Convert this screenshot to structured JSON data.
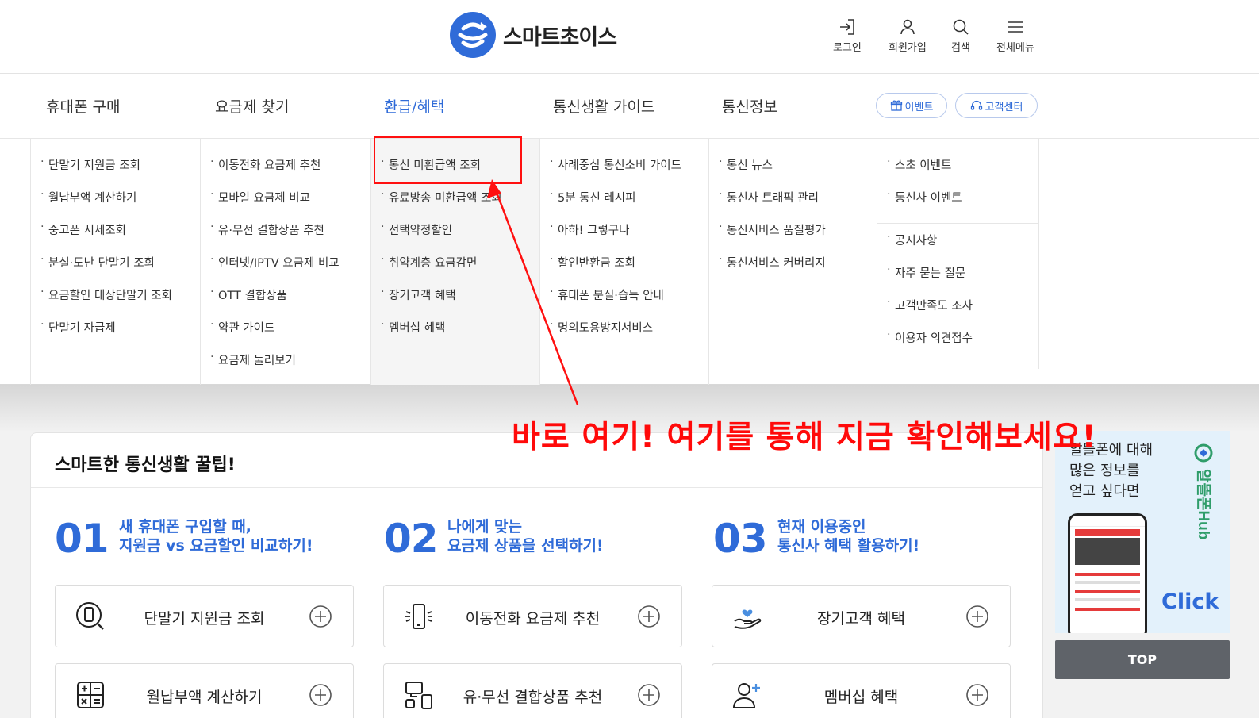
{
  "header": {
    "logo_text": "스마트초이스",
    "util": {
      "login": "로그인",
      "signup": "회원가입",
      "search": "검색",
      "all_menu": "전체메뉴"
    }
  },
  "gnb": {
    "items": [
      "휴대폰 구매",
      "요금제 찾기",
      "환급/혜택",
      "통신생활 가이드",
      "통신정보"
    ],
    "event_label": "이벤트",
    "support_label": "고객센터"
  },
  "mega_menu": {
    "col1": [
      "단말기 지원금 조회",
      "월납부액 계산하기",
      "중고폰 시세조회",
      "분실·도난 단말기 조회",
      "요금할인 대상단말기 조회",
      "단말기 자급제"
    ],
    "col2": [
      "이동전화 요금제 추천",
      "모바일 요금제 비교",
      "유·무선 결합상품 추천",
      "인터넷/IPTV 요금제 비교",
      "OTT 결합상품",
      "약관 가이드",
      "요금제 둘러보기"
    ],
    "col3": [
      "통신 미환급액 조회",
      "유료방송 미환급액 조회",
      "선택약정할인",
      "취약계층 요금감면",
      "장기고객 혜택",
      "멤버십 혜택"
    ],
    "col4": [
      "사례중심 통신소비 가이드",
      "5분 통신 레시피",
      "아하! 그렇구나",
      "할인반환금 조회",
      "휴대폰 분실·습득 안내",
      "명의도용방지서비스"
    ],
    "col5": [
      "통신 뉴스",
      "통신사 트래픽 관리",
      "통신서비스 품질평가",
      "통신서비스 커버리지"
    ],
    "col6_top": [
      "스초 이벤트",
      "통신사 이벤트"
    ],
    "col6_bottom": [
      "공지사항",
      "자주 묻는 질문",
      "고객만족도 조사",
      "이용자 의견접수"
    ]
  },
  "annotation": {
    "text": "바로 여기! 여기를 통해 지금 확인해보세요!",
    "color": "#ff0a0a"
  },
  "tips": {
    "title": "스마트한 통신생활 꿀팁!",
    "sections": [
      {
        "num": "01",
        "line1": "새 휴대폰 구입할 때,",
        "line2": "지원금 vs 요금할인 비교하기!",
        "items": [
          "단말기 지원금 조회",
          "월납부액 계산하기"
        ]
      },
      {
        "num": "02",
        "line1": "나에게 맞는",
        "line2": "요금제 상품을 선택하기!",
        "items": [
          "이동전화 요금제 추천",
          "유·무선 결합상품 추천"
        ]
      },
      {
        "num": "03",
        "line1": "현재 이용중인",
        "line2": "통신사 혜택 활용하기!",
        "items": [
          "장기고객 혜택",
          "멤버십 혜택"
        ]
      }
    ]
  },
  "banner": {
    "line1": "알뜰폰에 대해",
    "line2": "많은 정보를",
    "line3": "얻고 싶다면",
    "brand": "알뜰폰Hub",
    "click": "Click"
  },
  "top_button": "TOP",
  "colors": {
    "accent": "#2f6bd8",
    "annotation": "#ff0a0a",
    "top_button": "#5f6369"
  }
}
